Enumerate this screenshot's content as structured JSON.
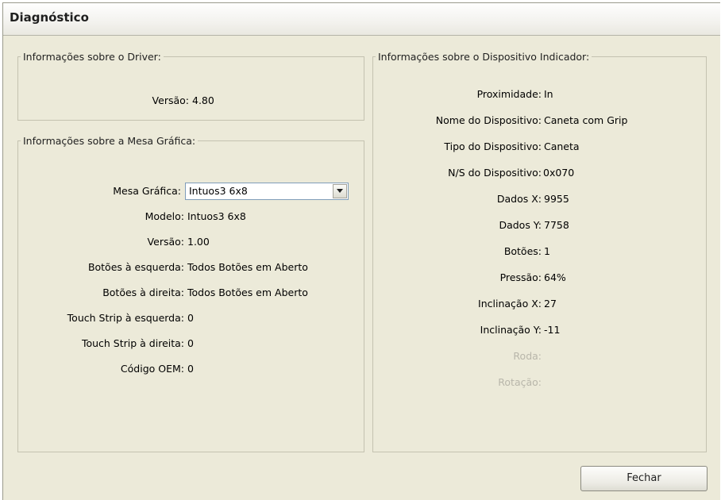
{
  "window": {
    "title": "Diagnóstico"
  },
  "driver_group": {
    "legend": "Informações sobre o Driver:",
    "rows": [
      {
        "label": "Versão:",
        "value": "4.80"
      }
    ]
  },
  "tablet_group": {
    "legend": "Informações sobre a Mesa Gráfica:",
    "tablet_select": {
      "label": "Mesa Gráfica:",
      "value": "Intuos3 6x8"
    },
    "rows": [
      {
        "label": "Modelo:",
        "value": "Intuos3 6x8"
      },
      {
        "label": "Versão:",
        "value": "1.00"
      },
      {
        "label": "Botões à esquerda:",
        "value": "Todos Botões em Aberto"
      },
      {
        "label": "Botões à direita:",
        "value": "Todos Botões em Aberto"
      },
      {
        "label": "Touch Strip à esquerda:",
        "value": "0"
      },
      {
        "label": "Touch Strip à direita:",
        "value": "0"
      },
      {
        "label": "Código OEM:",
        "value": "0"
      }
    ]
  },
  "pointer_group": {
    "legend": "Informações sobre o Dispositivo Indicador:",
    "rows": [
      {
        "label": "Proximidade:",
        "value": "In"
      },
      {
        "label": "Nome do Dispositivo:",
        "value": "Caneta com Grip"
      },
      {
        "label": "Tipo do Dispositivo:",
        "value": "Caneta"
      },
      {
        "label": "N/S do Dispositivo:",
        "value": "0x070"
      },
      {
        "label": "Dados X:",
        "value": "9955"
      },
      {
        "label": "Dados Y:",
        "value": "7758"
      },
      {
        "label": "Botões:",
        "value": "1"
      },
      {
        "label": "Pressão:",
        "value": "64%"
      },
      {
        "label": "Inclinação X:",
        "value": "27"
      },
      {
        "label": "Inclinação Y:",
        "value": "-11"
      },
      {
        "label": "Roda:",
        "value": ""
      },
      {
        "label": "Rotação:",
        "value": ""
      }
    ]
  },
  "buttons": {
    "close_label": "Fechar"
  }
}
